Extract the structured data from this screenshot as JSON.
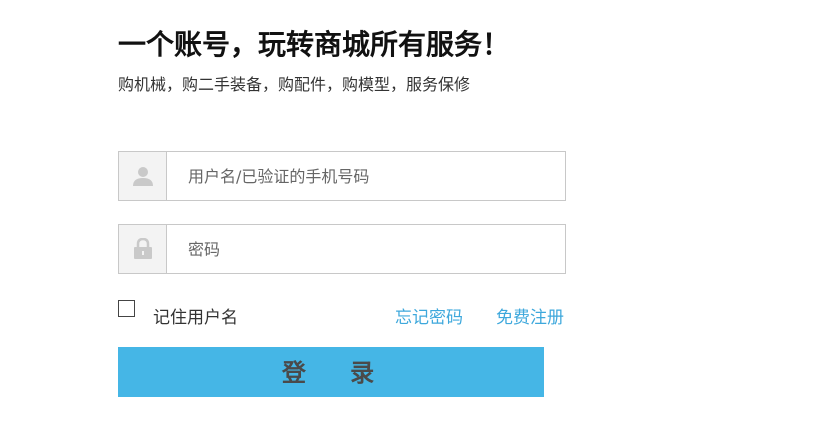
{
  "header": {
    "title": "一个账号，玩转商城所有服务！",
    "subtitle": "购机械，购二手装备，购配件，购模型，服务保修"
  },
  "form": {
    "username": {
      "icon": "user-icon",
      "placeholder": "用户名/已验证的手机号码",
      "value": ""
    },
    "password": {
      "icon": "lock-icon",
      "placeholder": "密码",
      "value": ""
    },
    "remember_label": "记住用户名",
    "remember_checked": false,
    "forgot_password_label": "忘记密码",
    "register_label": "免费注册",
    "login_label": "登 录"
  },
  "colors": {
    "accent": "#45b6e6",
    "link": "#3ea8dc",
    "icon_gray": "#c9c9c9"
  }
}
